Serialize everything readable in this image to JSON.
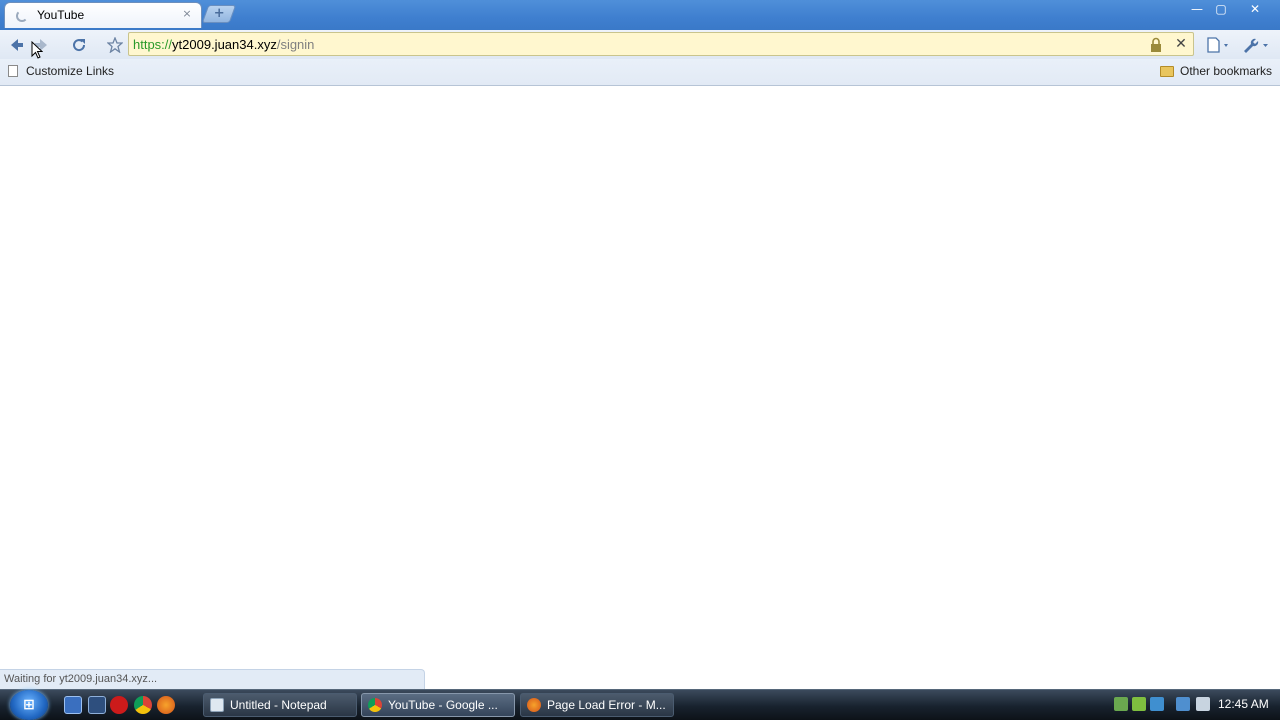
{
  "browser": {
    "tab": {
      "title": "YouTube",
      "close_label": "×",
      "new_tab_label": "+"
    },
    "window_controls": {
      "minimize": "—",
      "maximize": "▢",
      "close": "✕"
    },
    "toolbar": {
      "back_icon": "arrow-left-icon",
      "forward_icon": "arrow-right-icon",
      "reload_icon": "reload-icon",
      "star_icon": "star-icon",
      "stop_label": "✕",
      "page_menu_label": "▤▾",
      "wrench_menu_label": "🔧▾"
    },
    "omnibox": {
      "scheme": "https://",
      "host": "yt2009.juan34.xyz",
      "path": "/signin"
    },
    "bookmarks_bar": {
      "customize_label": "Customize Links",
      "other_label": "Other bookmarks"
    },
    "status_bubble": "Waiting for yt2009.juan34.xyz..."
  },
  "taskbar": {
    "start_label": "⊞",
    "tasks": [
      {
        "label": "Untitled - Notepad"
      },
      {
        "label": "YouTube - Google ..."
      },
      {
        "label": "Page Load Error - M..."
      }
    ],
    "clock": "12:45 AM"
  }
}
